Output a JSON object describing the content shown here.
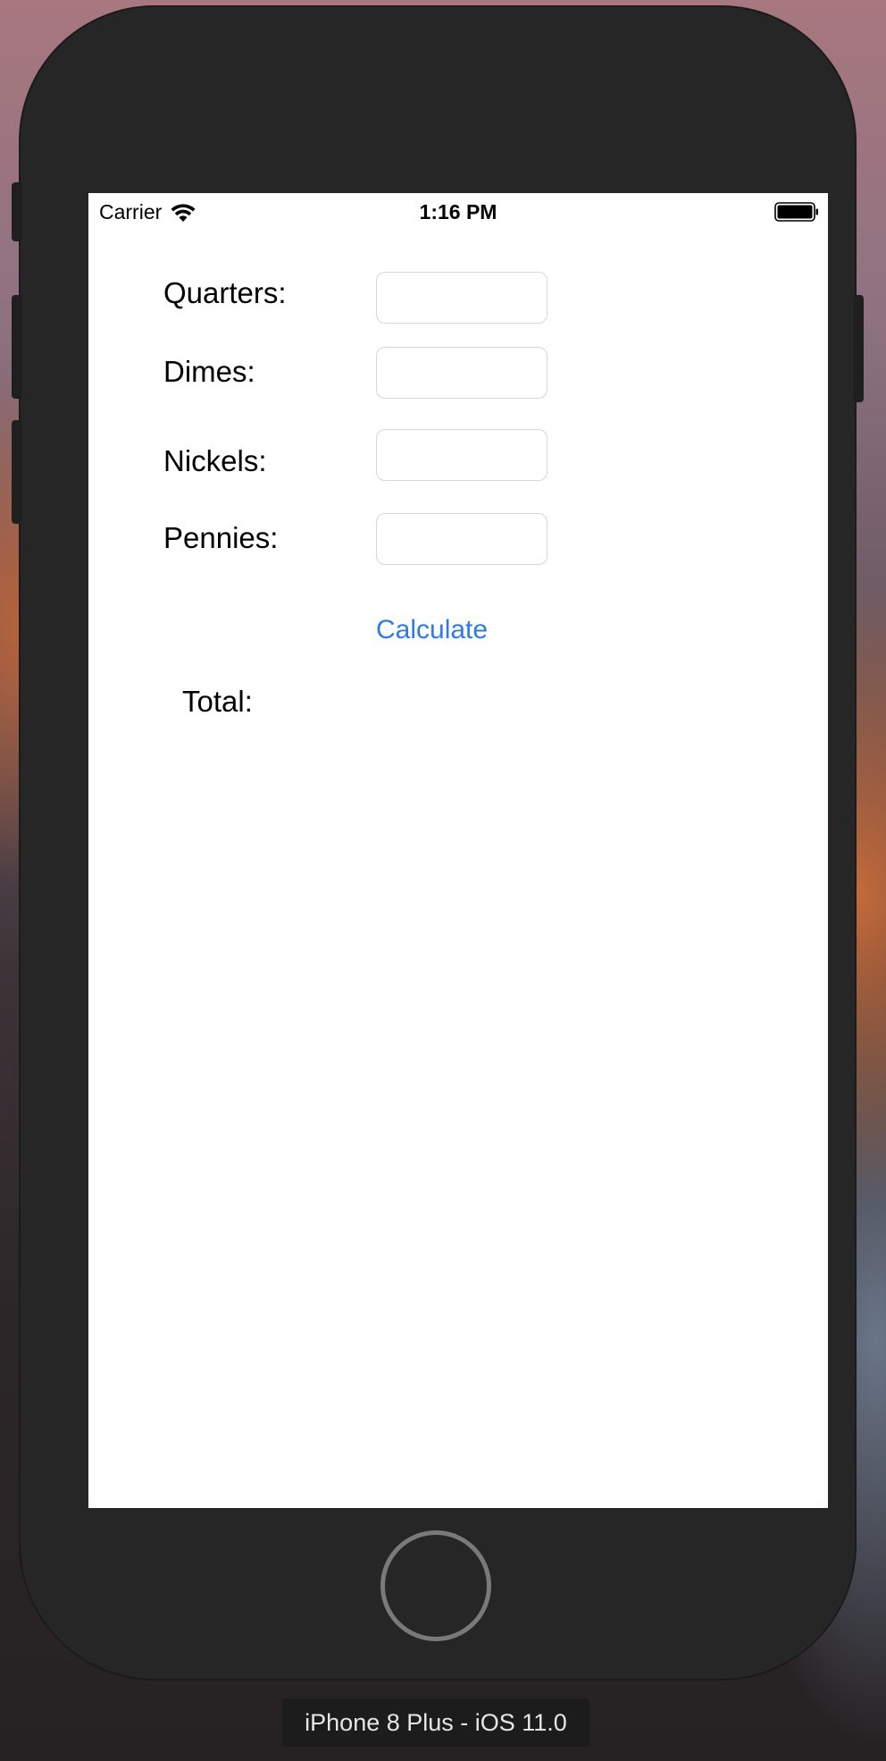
{
  "status_bar": {
    "carrier": "Carrier",
    "time": "1:16 PM",
    "wifi_icon": "wifi-icon",
    "battery_icon": "battery-full-icon"
  },
  "form": {
    "quarters": {
      "label": "Quarters:",
      "value": "",
      "placeholder": ""
    },
    "dimes": {
      "label": "Dimes:",
      "value": "",
      "placeholder": ""
    },
    "nickels": {
      "label": "Nickels:",
      "value": "",
      "placeholder": ""
    },
    "pennies": {
      "label": "Pennies:",
      "value": "",
      "placeholder": ""
    }
  },
  "calculate_label": "Calculate",
  "total_label": "Total:",
  "simulator": {
    "device_label": "iPhone 8 Plus - iOS 11.0"
  },
  "colors": {
    "accent": "#2f7bdf",
    "device_body": "#262626"
  }
}
